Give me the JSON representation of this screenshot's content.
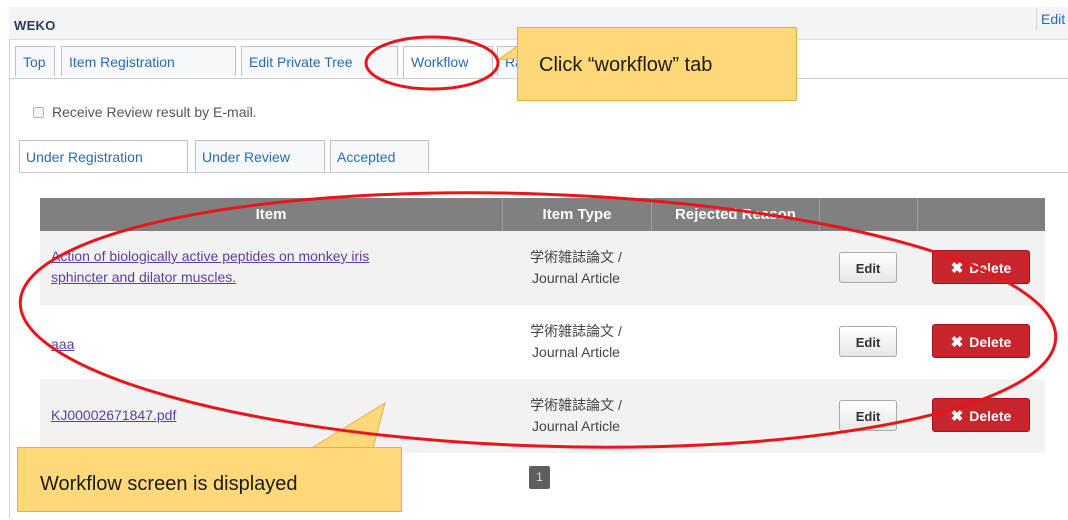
{
  "header": {
    "brand": "WEKO",
    "edit_label": "Edit"
  },
  "main_tabs": [
    {
      "label": "Top"
    },
    {
      "label": "Item Registration"
    },
    {
      "label": "Edit Private Tree"
    },
    {
      "label": "Workflow"
    },
    {
      "label": "Ra"
    }
  ],
  "review_checkbox": {
    "label": "Receive Review result by E-mail.",
    "checked": false
  },
  "workflow_tabs": [
    {
      "label": "Under Registration"
    },
    {
      "label": "Under Review"
    },
    {
      "label": "Accepted"
    }
  ],
  "table": {
    "headers": {
      "item": "Item",
      "item_type": "Item Type",
      "rejected_reason": "Rejected Reason"
    },
    "rows": [
      {
        "item_line1": "Action of biologically active peptides on monkey iris",
        "item_line2": "sphincter and dilator muscles.",
        "type_line1": "学術雑誌論文 /",
        "type_line2": "Journal Article",
        "edit": "Edit",
        "delete": "Delete"
      },
      {
        "item_line1": "aaa",
        "item_line2": "",
        "type_line1": "学術雑誌論文 /",
        "type_line2": "Journal Article",
        "edit": "Edit",
        "delete": "Delete"
      },
      {
        "item_line1": "KJ00002671847.pdf",
        "item_line2": "",
        "type_line1": "学術雑誌論文 /",
        "type_line2": "Journal Article",
        "edit": "Edit",
        "delete": "Delete"
      }
    ]
  },
  "pagination": {
    "current_page": "1"
  },
  "annotations": {
    "top_callout": "Click “workflow” tab",
    "bottom_callout": "Workflow screen is displayed",
    "highlight_color": "#e8151b",
    "callout_color": "#ffd87a"
  }
}
